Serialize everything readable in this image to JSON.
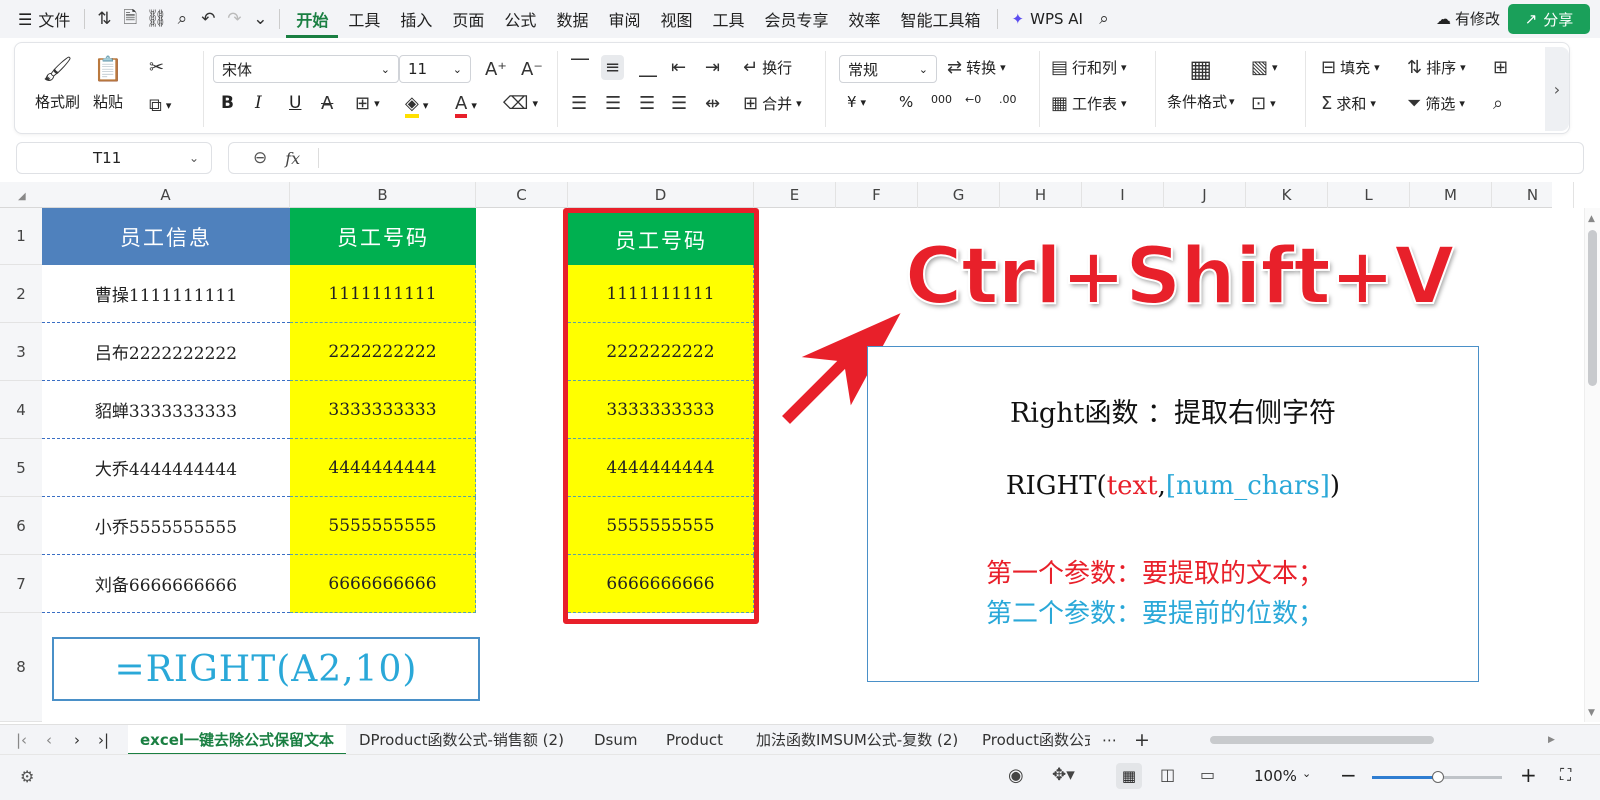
{
  "menubar": {
    "file_label": "文件",
    "tabs": [
      "开始",
      "工具",
      "插入",
      "页面",
      "公式",
      "数据",
      "审阅",
      "视图",
      "工具",
      "会员专享",
      "效率",
      "智能工具箱"
    ],
    "wps_ai": "WPS AI",
    "revise": "有修改",
    "share": "分享"
  },
  "ribbon": {
    "format_painter": "格式刷",
    "paste": "粘贴",
    "font_name": "宋体",
    "font_size": "11",
    "bold": "B",
    "italic": "I",
    "underline": "U",
    "wrap": "换行",
    "merge": "合并",
    "number_format": "常规",
    "convert": "转换",
    "row_col": "行和列",
    "worksheet": "工作表",
    "cond_format": "条件格式",
    "fill": "填充",
    "sort": "排序",
    "sum": "求和",
    "filter": "筛选",
    "yen": "¥",
    "percent": "%",
    "thousands": "000",
    "dec_inc": "←0",
    "dec_dec": ".00"
  },
  "formula_bar": {
    "cell_ref": "T11",
    "fx": "fx",
    "content": ""
  },
  "columns": [
    "A",
    "B",
    "C",
    "D",
    "E",
    "F",
    "G",
    "H",
    "I",
    "J",
    "K",
    "L",
    "M",
    "N"
  ],
  "rows": [
    "1",
    "2",
    "3",
    "4",
    "5",
    "6",
    "7",
    "8"
  ],
  "table_a": {
    "header": "员工信息",
    "values": [
      "曹操1111111111",
      "吕布2222222222",
      "貂蝉3333333333",
      "大乔4444444444",
      "小乔5555555555",
      "刘备6666666666"
    ]
  },
  "table_b": {
    "header": "员工号码",
    "values": [
      "1111111111",
      "2222222222",
      "3333333333",
      "4444444444",
      "5555555555",
      "6666666666"
    ]
  },
  "table_d": {
    "header": "员工号码",
    "values": [
      "1111111111",
      "2222222222",
      "3333333333",
      "4444444444",
      "5555555555",
      "6666666666"
    ]
  },
  "formula_box": "=RIGHT(A2,10)",
  "shortcut": "Ctrl+Shift+V",
  "info_box": {
    "line1": "Right函数 ：提取右侧字符",
    "syntax_prefix": "RIGHT(",
    "syntax_arg1": "text",
    "syntax_comma": ",",
    "syntax_arg2": "[num_chars]",
    "syntax_suffix": ")",
    "param1": "第一个参数：要提取的文本；",
    "param2": "第二个参数：要提前的位数；"
  },
  "sheet_tabs": [
    "excel一键去除公式保留文本",
    "DProduct函数公式-销售额 (2)",
    "Dsum",
    "Product",
    "加法函数IMSUM公式-复数 (2)",
    "Product函数公式"
  ],
  "status": {
    "zoom": "100%"
  },
  "colors": {
    "header_blue": "#4f81bd",
    "header_green": "#00b050",
    "yellow": "#ffff00",
    "red": "#e8202a",
    "cyan": "#2aa8d8",
    "accent_green": "#1a7f42"
  }
}
